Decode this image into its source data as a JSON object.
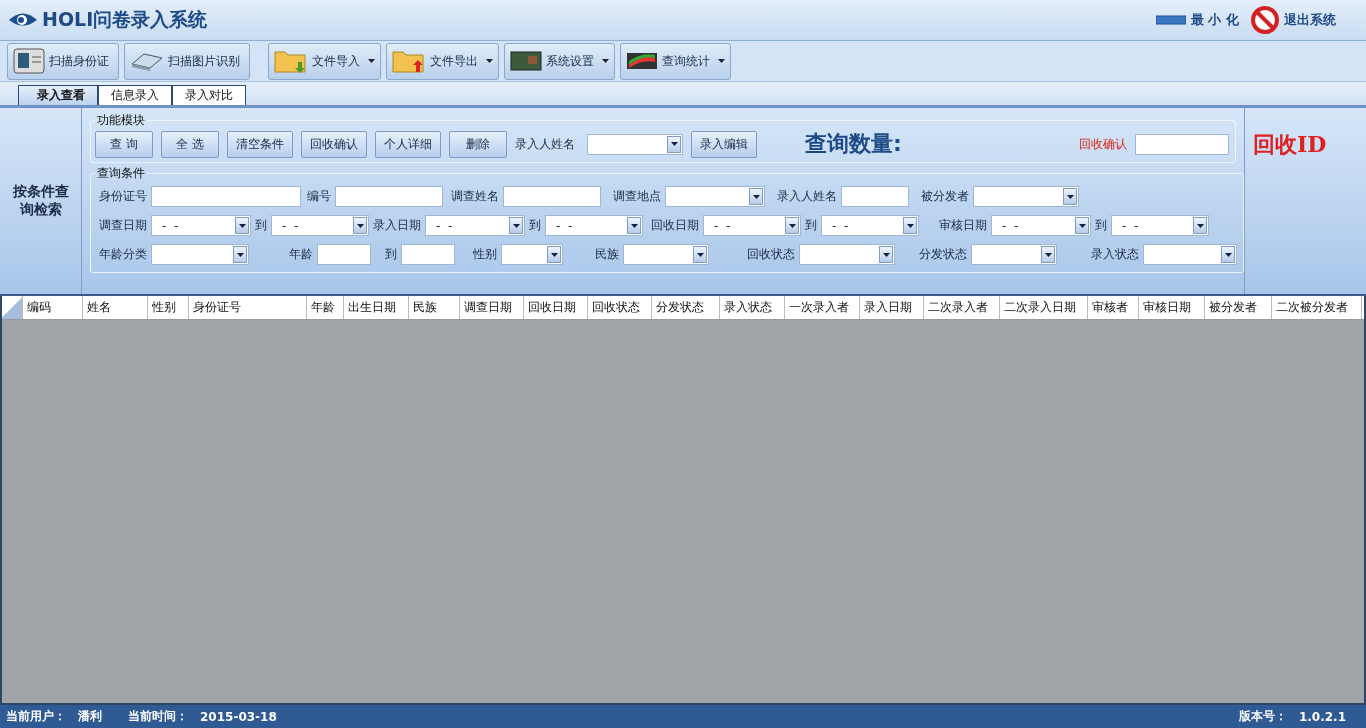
{
  "window": {
    "title": "HOLI问卷录入系统",
    "minimize": "最 小 化",
    "exit": "退出系统"
  },
  "toolbar": [
    {
      "label": "扫描身份证",
      "kind": "id",
      "dropdown": false
    },
    {
      "label": "扫描图片识别",
      "kind": "scanner",
      "dropdown": false
    },
    {
      "label": "文件导入",
      "kind": "import",
      "dropdown": true
    },
    {
      "label": "文件导出",
      "kind": "export",
      "dropdown": true
    },
    {
      "label": "系统设置",
      "kind": "board",
      "dropdown": true
    },
    {
      "label": "查询统计",
      "kind": "chart",
      "dropdown": true
    }
  ],
  "tabs": [
    {
      "label": "录入查看",
      "selected": true
    },
    {
      "label": "信息录入",
      "selected": false
    },
    {
      "label": "录入对比",
      "selected": false
    }
  ],
  "side_label": "按条件查询检索",
  "function_module": {
    "title": "功能模块",
    "buttons": [
      "查  询",
      "全  选",
      "清空条件",
      "回收确认",
      "个人详细",
      "删除"
    ],
    "entry_name_label": "录入人姓名",
    "edit_button": "录入编辑",
    "count_label": "查询数量:",
    "confirm_label": "回收确认"
  },
  "recycle_id": "回收ID",
  "query": {
    "title": "查询条件",
    "identity_fields": [
      {
        "label": "身份证号",
        "kind": "text"
      },
      {
        "label": "编号",
        "kind": "text"
      },
      {
        "label": "调查姓名",
        "kind": "text"
      },
      {
        "label": "调查地点",
        "kind": "combo"
      },
      {
        "label": "录入人姓名",
        "kind": "text"
      },
      {
        "label": "被分发者",
        "kind": "combo"
      }
    ],
    "date_fields": [
      {
        "label": "调查日期",
        "kind": "date",
        "value": "-  -"
      },
      {
        "label": "到",
        "kind": "date",
        "value": "-  -"
      },
      {
        "label": "录入日期",
        "kind": "date",
        "value": "-  -"
      },
      {
        "label": "到",
        "kind": "date",
        "value": "-  -"
      },
      {
        "label": "回收日期",
        "kind": "date",
        "value": "-  -"
      },
      {
        "label": "到",
        "kind": "date",
        "value": "-  -"
      },
      {
        "label": "审核日期",
        "kind": "date",
        "value": "-  -"
      },
      {
        "label": "到",
        "kind": "date",
        "value": "-  -"
      }
    ],
    "status_fields": [
      {
        "label": "年龄分类",
        "kind": "combo"
      },
      {
        "label": "年龄",
        "kind": "text"
      },
      {
        "label": "到",
        "kind": "text"
      },
      {
        "label": "性别",
        "kind": "combo"
      },
      {
        "label": "民族",
        "kind": "combo"
      },
      {
        "label": "回收状态",
        "kind": "combo"
      },
      {
        "label": "分发状态",
        "kind": "combo"
      },
      {
        "label": "录入状态",
        "kind": "combo"
      }
    ]
  },
  "table": {
    "columns": [
      "编码",
      "姓名",
      "性别",
      "身份证号",
      "年龄",
      "出生日期",
      "民族",
      "调查日期",
      "回收日期",
      "回收状态",
      "分发状态",
      "录入状态",
      "一次录入者",
      "录入日期",
      "二次录入者",
      "二次录入日期",
      "审核者",
      "审核日期",
      "被分发者",
      "二次被分发者"
    ]
  },
  "status_bar": {
    "user_label": "当前用户：",
    "user": "潘利",
    "time_label": "当前时间：",
    "date": "2015-03-18",
    "version_label": "版本号：",
    "version": "1.0.2.1"
  }
}
